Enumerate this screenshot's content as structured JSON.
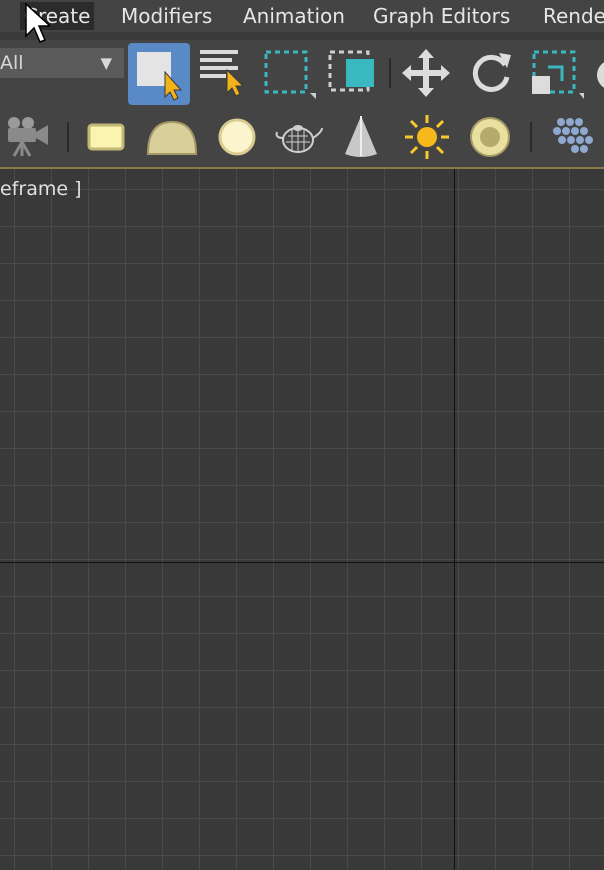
{
  "menu": {
    "items": [
      {
        "label": "Create",
        "active": true
      },
      {
        "label": "Modifiers"
      },
      {
        "label": "Animation"
      },
      {
        "label": "Graph Editors"
      },
      {
        "label": "Rende"
      }
    ]
  },
  "toolbar": {
    "selection_filter": "All",
    "dropdown_arrow": "▼",
    "icons": [
      "select-object-icon",
      "select-by-name-icon",
      "rectangular-selection-region-icon",
      "window-crossing-icon",
      "move-icon",
      "rotate-icon",
      "scale-icon"
    ]
  },
  "render_toolbar": {
    "icons": [
      "camera-icon",
      "area-light-icon",
      "dome-light-icon",
      "sphere-light-icon",
      "teapot-icon",
      "cone-light-icon",
      "sun-icon",
      "disc-light-icon",
      "grid-object-icon"
    ]
  },
  "viewport": {
    "label": "eframe ]"
  },
  "colors": {
    "menu_bg": "#444444",
    "viewport_bg": "#393939",
    "active_button": "#5a8ac6",
    "accent_teal": "#3ab8c0",
    "cursor_yellow": "#f2b21a"
  }
}
